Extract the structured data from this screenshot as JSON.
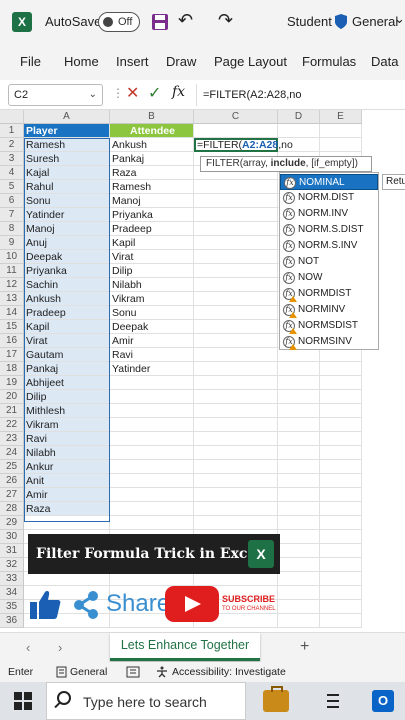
{
  "titlebar": {
    "app_logo": "X",
    "autosave_label": "AutoSave",
    "toggle_state": "Off",
    "user": "Student",
    "sensitivity": "General",
    "sensitivity_chev": "⌄",
    "undo_icon": "↶",
    "redo_icon": "↷"
  },
  "menu": [
    "File",
    "Home",
    "Insert",
    "Draw",
    "Page Layout",
    "Formulas",
    "Data"
  ],
  "formula_bar": {
    "name_box": "C2",
    "cancel_icon": "✕",
    "enter_icon": "✓",
    "fx_label": "fx",
    "formula": "=FILTER(A2:A28,no"
  },
  "grid": {
    "columns": [
      "A",
      "B",
      "C",
      "D",
      "E"
    ],
    "row_numbers": [
      "1",
      "2",
      "3",
      "4",
      "5",
      "6",
      "7",
      "8",
      "9",
      "10",
      "11",
      "12",
      "13",
      "14",
      "15",
      "16",
      "17",
      "18",
      "19",
      "20",
      "21",
      "22",
      "23",
      "24",
      "25",
      "26",
      "27",
      "28",
      "29",
      "30",
      "31",
      "32",
      "33",
      "34",
      "35",
      "36"
    ],
    "header_player": "Player",
    "header_attendee": "Attendee",
    "players": [
      "Ramesh",
      "Suresh",
      "Kajal",
      "Rahul",
      "Sonu",
      "Yatinder",
      "Manoj",
      "Anuj",
      "Deepak",
      "Priyanka",
      "Sachin",
      "Ankush",
      "Pradeep",
      "Kapil",
      "Virat",
      "Gautam",
      "Pankaj",
      "Abhijeet",
      "Dilip",
      "Mithlesh",
      "Vikram",
      "Ravi",
      "Nilabh",
      "Ankur",
      "Anit",
      "Amir",
      "Raza"
    ],
    "attendees": [
      "Ankush",
      "Pankaj",
      "Raza",
      "Ramesh",
      "Manoj",
      "Priyanka",
      "Pradeep",
      "Kapil",
      "Virat",
      "Dilip",
      "Nilabh",
      "Vikram",
      "Sonu",
      "Deepak",
      "Amir",
      "Ravi",
      "Yatinder"
    ],
    "active_cell": {
      "prefix": "=FILTER(",
      "ref": "A2:A28",
      "suffix": ",no"
    }
  },
  "tooltip": {
    "func": "FILTER(",
    "arg1": "array, ",
    "arg2": "include",
    "rest": ", [if_empty])"
  },
  "autocomplete": {
    "items": [
      "NOMINAL",
      "NORM.DIST",
      "NORM.INV",
      "NORM.S.DIST",
      "NORM.S.INV",
      "NOT",
      "NOW",
      "NORMDIST",
      "NORMINV",
      "NORMSDIST",
      "NORMSINV"
    ],
    "icon_label": "fx",
    "desc_preview": "Retu"
  },
  "promo": {
    "banner_text": "Filter Formula Trick in  Excel",
    "banner_logo": "X",
    "share_label": "Share",
    "subscribe_label": "SUBSCRIBE",
    "subscribe_sub": "TO OUR CHANNEL"
  },
  "sheet_bar": {
    "prev_arrow": "‹",
    "next_arrow": "›",
    "active_sheet": "Lets Enhance Together",
    "add_symbol": "+"
  },
  "status_bar": {
    "mode": "Enter",
    "sensitivity": "General",
    "accessibility": "Accessibility: Investigate"
  },
  "taskbar": {
    "search_placeholder": "Type here to search",
    "outlook_label": "O"
  },
  "colors": {
    "excel_green": "#217346",
    "player_header": "#1a73c2",
    "attendee_header": "#8cc63f",
    "youtube_red": "#e01e1e",
    "share_blue": "#3a8fd0"
  }
}
